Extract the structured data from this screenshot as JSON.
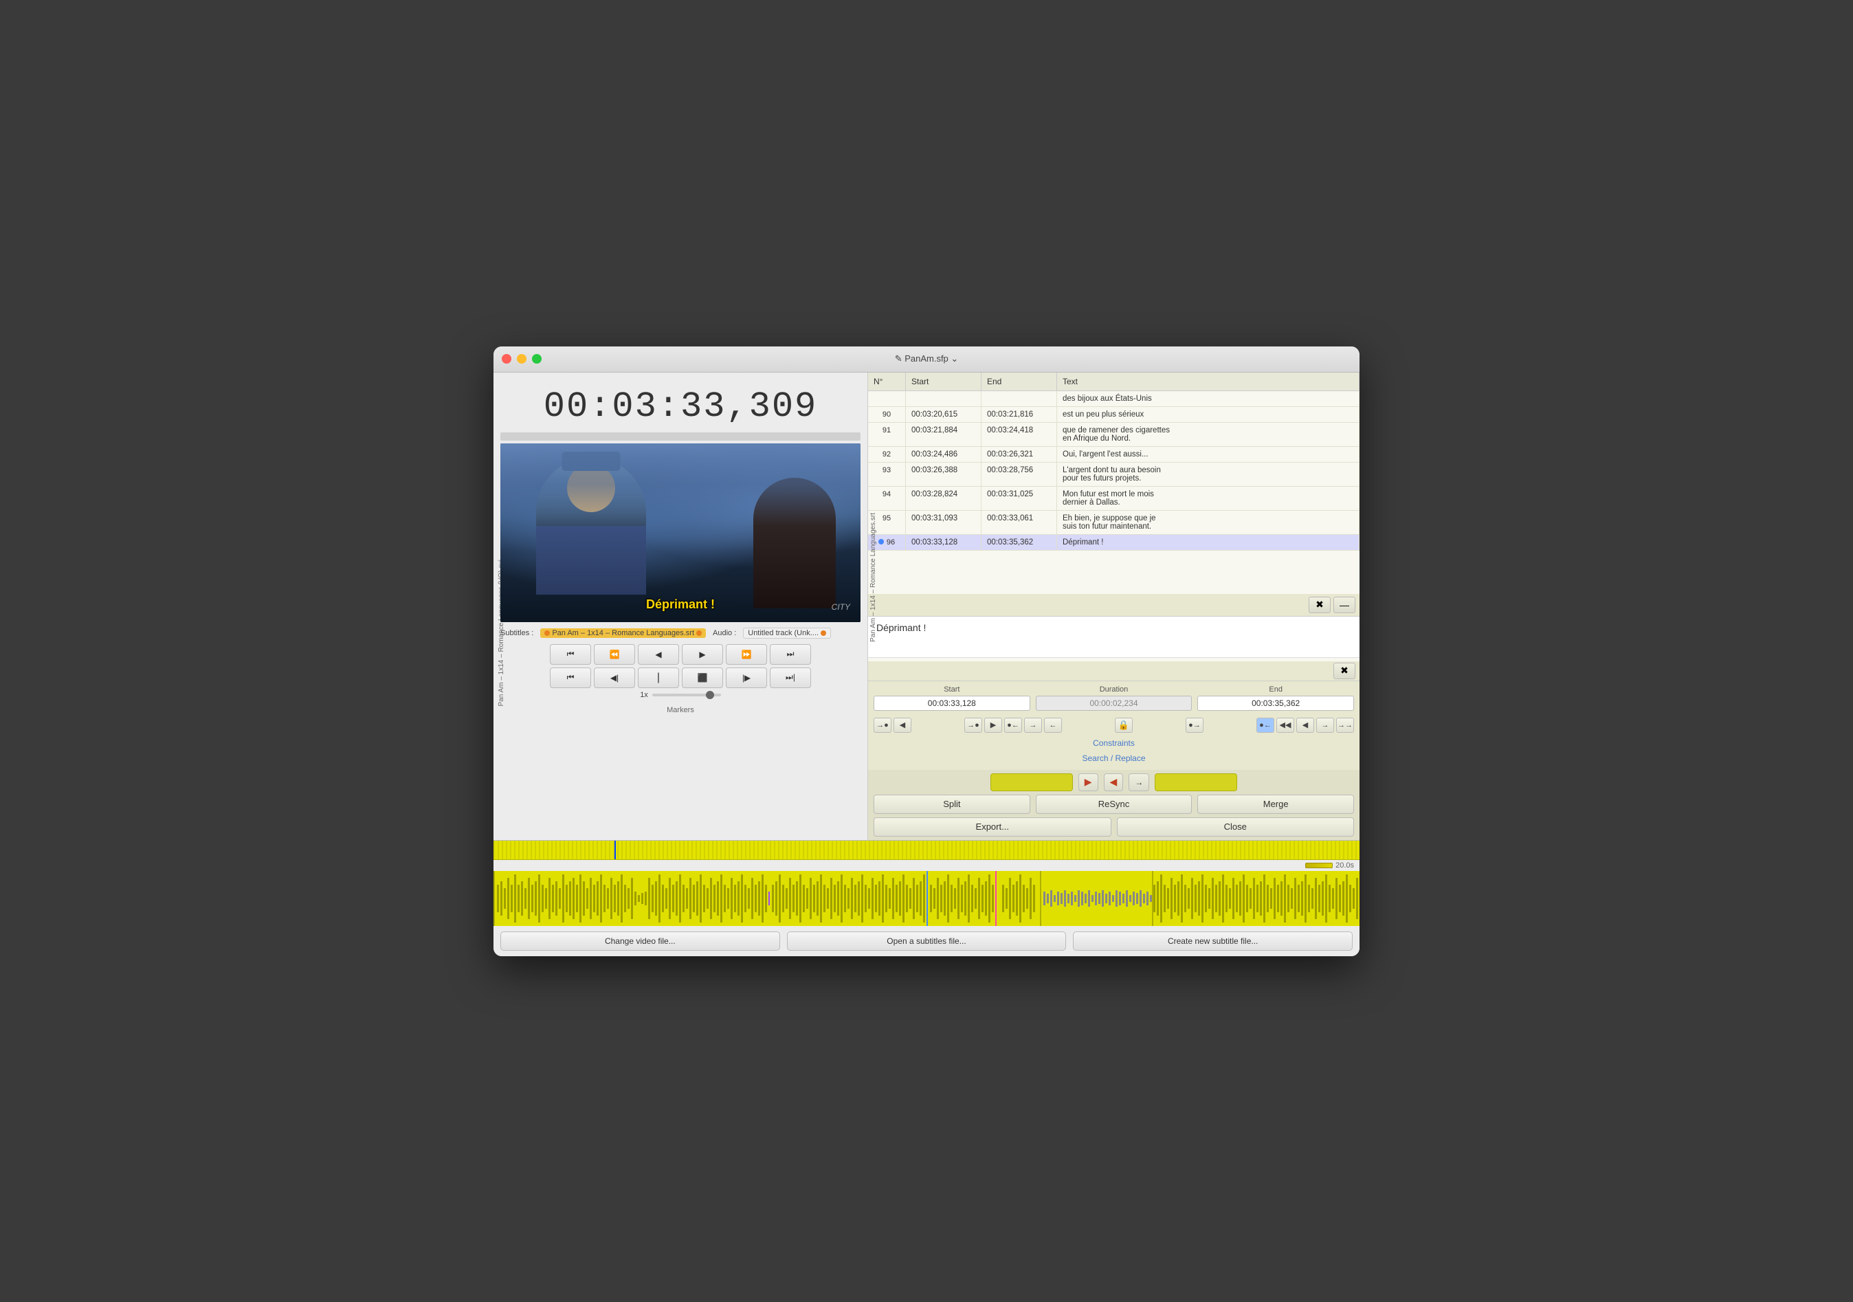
{
  "window": {
    "title": "✎ PanAm.sfp ⌄"
  },
  "left_panel": {
    "timecode": "00:03:33,309",
    "vertical_label": "Pan Am – 1x14 – Romance Languages (VO).avi",
    "subtitle_label": "Subtitles :",
    "sub_file": "Pan Am – 1x14 – Romance Languages.srt",
    "audio_label": "Audio :",
    "audio_file": "Untitled track (Unk....",
    "markers_label": "Markers",
    "speed_label": "1x",
    "controls": {
      "row1": [
        "⏮",
        "⏪",
        "◀",
        "▶",
        "⏩",
        "⏭"
      ],
      "row2": [
        "⏮",
        "⏮|",
        "|",
        "⬛",
        "||⏭",
        "⏭|"
      ]
    }
  },
  "subtitle_table": {
    "columns": [
      "N°",
      "Start",
      "End",
      "Text"
    ],
    "rows": [
      {
        "num": "",
        "start": "",
        "end": "",
        "text": "des bijoux aux États-Unis",
        "active": false
      },
      {
        "num": "90",
        "start": "00:03:20,615",
        "end": "00:03:21,816",
        "text": "est un peu plus sérieux",
        "active": false
      },
      {
        "num": "91",
        "start": "00:03:21,884",
        "end": "00:03:24,418",
        "text": "que de ramener des cigarettes\nen Afrique du Nord.",
        "active": false
      },
      {
        "num": "92",
        "start": "00:03:24,486",
        "end": "00:03:26,321",
        "text": "Oui, l'argent l'est aussi...",
        "active": false
      },
      {
        "num": "93",
        "start": "00:03:26,388",
        "end": "00:03:28,756",
        "text": "L'argent dont tu aura besoin\npour tes futurs projets.",
        "active": false
      },
      {
        "num": "94",
        "start": "00:03:28,824",
        "end": "00:03:31,025",
        "text": "Mon futur est mort le mois\ndernier à Dallas.",
        "active": false
      },
      {
        "num": "95",
        "start": "00:03:31,093",
        "end": "00:03:33,061",
        "text": "Eh bien, je suppose que je\nsuis ton futur maintenant.",
        "active": false
      },
      {
        "num": "96",
        "start": "00:03:33,128",
        "end": "00:03:35,362",
        "text": "Déprimant !",
        "active": true
      }
    ]
  },
  "edit": {
    "text": "Déprimant !",
    "start": "00:03:33,128",
    "duration": "00:00:02,234",
    "end": "00:03:35,362",
    "start_label": "Start",
    "duration_label": "Duration",
    "end_label": "End"
  },
  "links": {
    "constraints": "Constraints",
    "search_replace": "Search / Replace"
  },
  "toolbar": {
    "split": "Split",
    "resync": "ReSync",
    "merge": "Merge",
    "export": "Export...",
    "close": "Close"
  },
  "bottom": {
    "btn1": "Change video file...",
    "btn2": "Open a subtitles file...",
    "btn3": "Create new subtitle file...",
    "scale": "20.0s"
  },
  "nav_buttons": {
    "left_group": [
      "→●",
      "◀"
    ],
    "right_group": [
      "●→"
    ],
    "right_nav": [
      "◀◀",
      "◀",
      "→◀"
    ],
    "lock": "🔒"
  }
}
